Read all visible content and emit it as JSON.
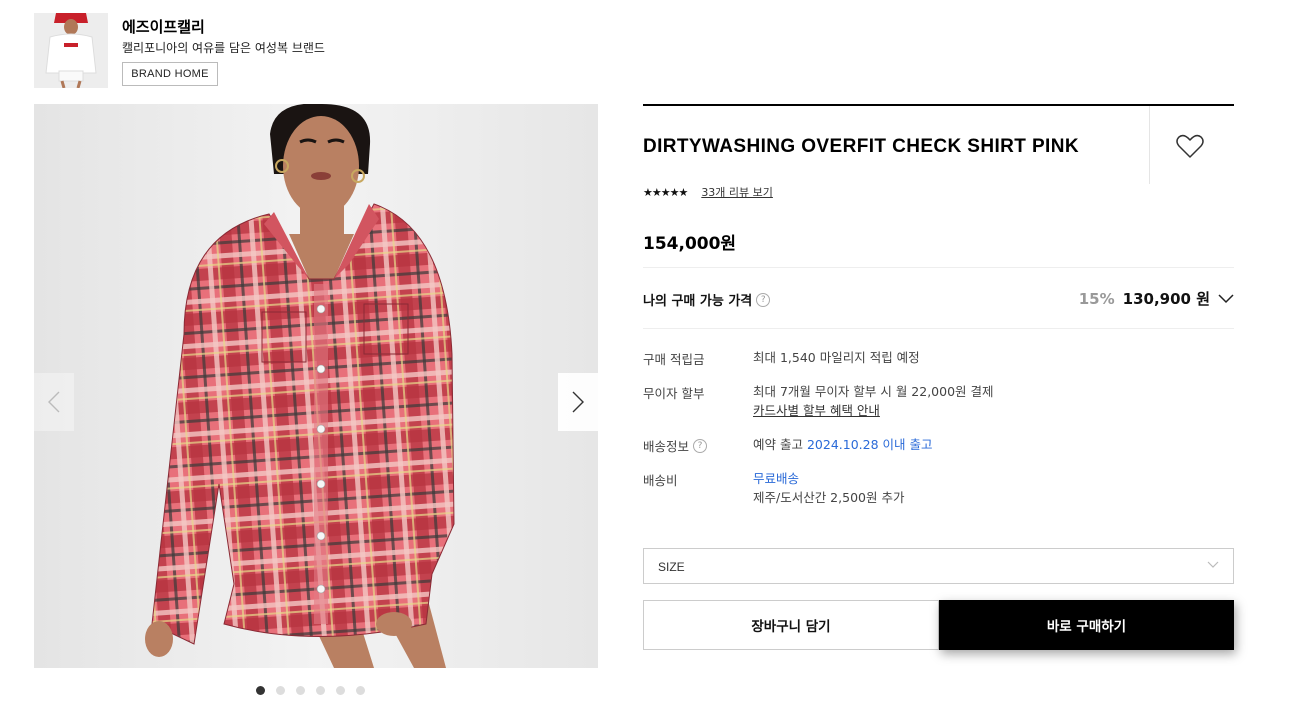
{
  "brand": {
    "name": "에즈이프캘리",
    "description": "캘리포니아의 여유를 담은 여성복 브랜드",
    "home_button": "BRAND HOME"
  },
  "gallery": {
    "slide_count": 6,
    "active_slide": 1
  },
  "product": {
    "title": "DIRTYWASHING OVERFIT CHECK SHIRT PINK",
    "rating_stars": "★★★★★",
    "review_link": "33개 리뷰 보기",
    "price": "154,000원",
    "my_price_label": "나의 구매 가능 가격",
    "discount": "15%",
    "my_price": "130,900 원"
  },
  "details": {
    "points_label": "구매 적립금",
    "points_value": "최대 1,540 마일리지 적립 예정",
    "installment_label": "무이자 할부",
    "installment_value": "최대 7개월 무이자 할부 시 월 22,000원 결제",
    "installment_link": "카드사별 할부 혜택 안내",
    "shipping_info_label": "배송정보",
    "shipping_info_prefix": "예약 출고",
    "shipping_info_date": "2024.10.28 이내 출고",
    "shipping_fee_label": "배송비",
    "shipping_fee_value": "무료배송",
    "shipping_fee_extra": "제주/도서산간 2,500원 추가"
  },
  "actions": {
    "size_placeholder": "SIZE",
    "cart_label": "장바구니 담기",
    "buy_label": "바로 구매하기"
  },
  "colors": {
    "accent_blue": "#2a6ad8",
    "shirt_pink": "#e8707a",
    "buy_button_bg": "#000000"
  }
}
